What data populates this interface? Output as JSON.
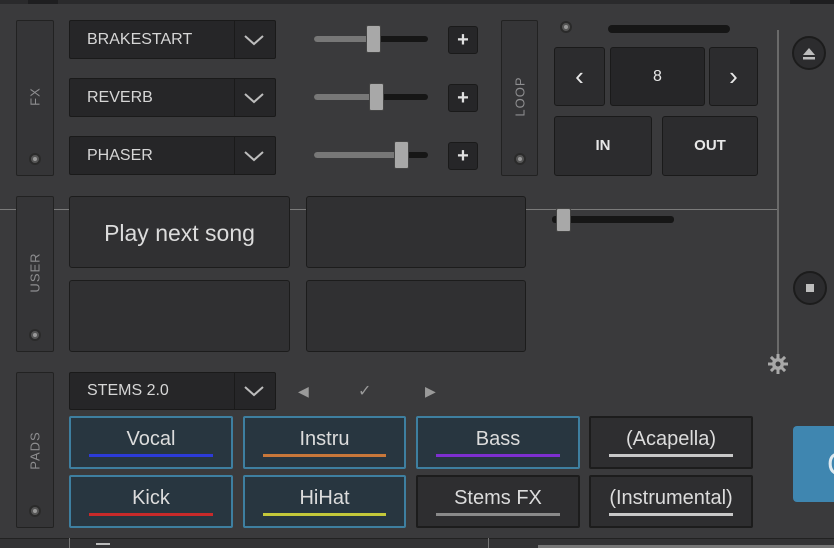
{
  "fx": {
    "label": "FX",
    "slots": [
      {
        "effect": "BRAKESTART",
        "level": 0.52
      },
      {
        "effect": "REVERB",
        "level": 0.54
      },
      {
        "effect": "PHASER",
        "level": 0.76
      }
    ],
    "add_label": "+"
  },
  "loop": {
    "label": "LOOP",
    "size": "8",
    "prev_glyph": "‹",
    "next_glyph": "›",
    "in_label": "IN",
    "out_label": "OUT",
    "level": 0.03
  },
  "user": {
    "label": "USER",
    "pads": [
      "Play next song",
      "",
      "",
      ""
    ]
  },
  "pads": {
    "label": "PADS",
    "mode": "STEMS 2.0",
    "prev_glyph": "◀",
    "check_glyph": "✓",
    "next_glyph": "▶",
    "stems": [
      {
        "label": "Vocal",
        "color": "#2c3bd8",
        "active": true
      },
      {
        "label": "Instru",
        "color": "#c8773a",
        "active": true
      },
      {
        "label": "Bass",
        "color": "#7e2fd0",
        "active": true
      },
      {
        "label": "(Acapella)",
        "color": "#c8c8c8",
        "active": false
      },
      {
        "label": "Kick",
        "color": "#c82a2a",
        "active": true
      },
      {
        "label": "HiHat",
        "color": "#c4c83a",
        "active": true
      },
      {
        "label": "Stems FX",
        "color": "#8a8a8a",
        "active": false
      },
      {
        "label": "(Instrumental)",
        "color": "#c8c8c8",
        "active": false
      }
    ]
  },
  "right": {
    "eject_icon": "eject-icon",
    "stop_icon": "stop-icon",
    "settings_icon": "gear-icon",
    "cut_label": "C"
  },
  "colors": {
    "active_border": "#3e7fa0",
    "active_bg": "#283640",
    "accent_blue": "#3f86b0"
  }
}
